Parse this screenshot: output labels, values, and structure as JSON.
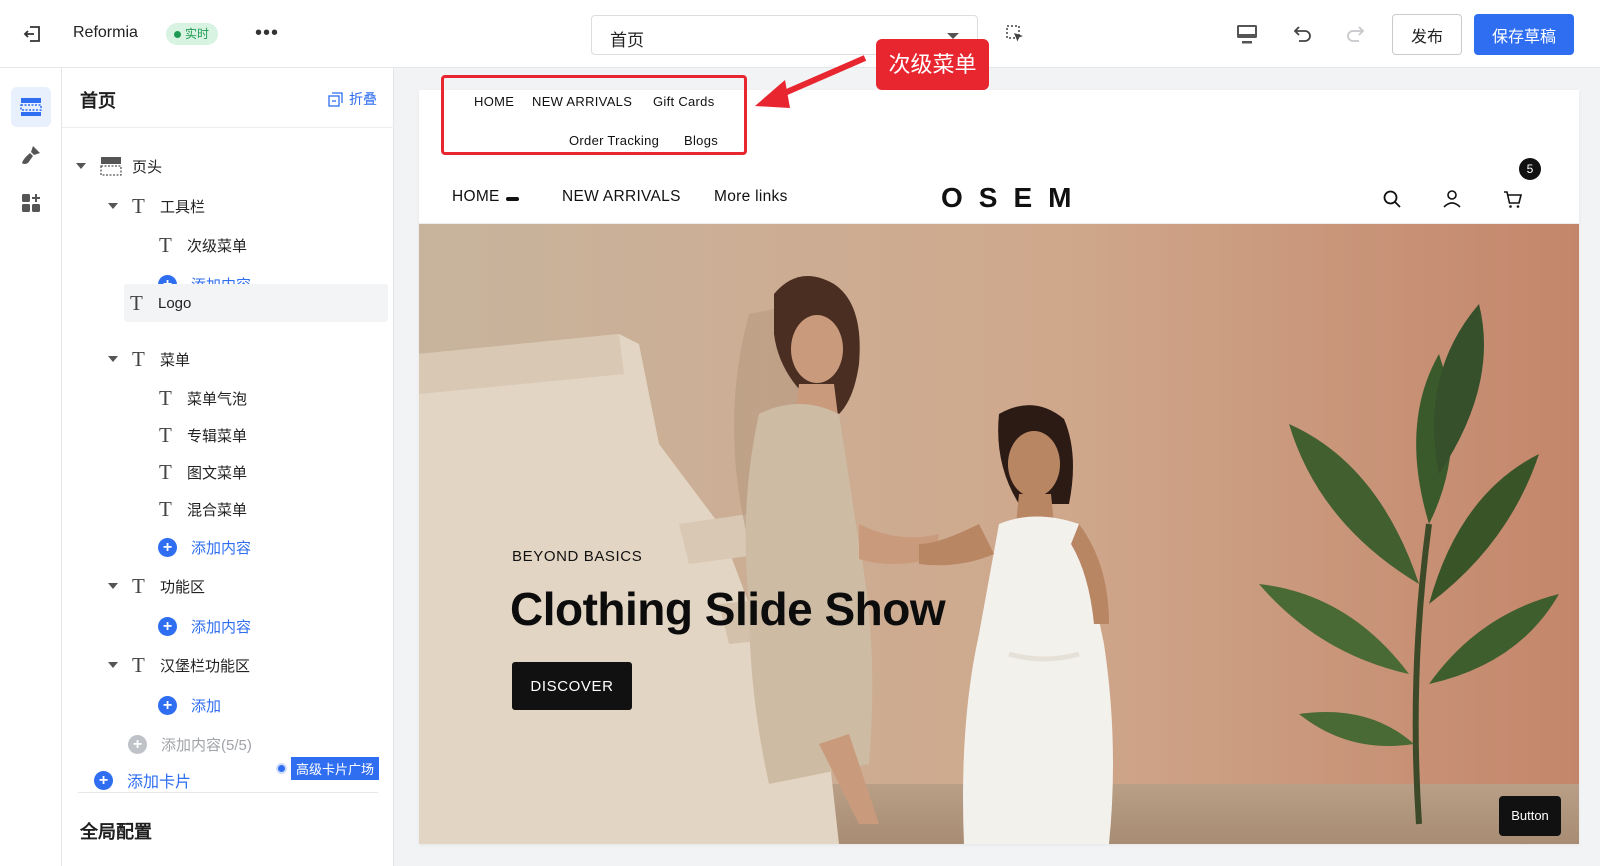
{
  "topbar": {
    "app_name": "Reformia",
    "live_badge": "实时",
    "more": "•••",
    "page_select": "首页",
    "publish": "发布",
    "save_draft": "保存草稿"
  },
  "panel": {
    "title": "首页",
    "collapse": "折叠",
    "tree": [
      {
        "label": "页头",
        "icon": "header-section-icon"
      },
      {
        "label": "工具栏",
        "icon": "text-t-icon"
      },
      {
        "label": "次级菜单",
        "icon": "text-t-icon"
      },
      {
        "label": "添加内容",
        "icon": "plus-circle-icon"
      },
      {
        "label": "Logo",
        "icon": "text-t-icon"
      },
      {
        "label": "菜单",
        "icon": "text-t-icon"
      },
      {
        "label": "菜单气泡",
        "icon": "text-t-icon"
      },
      {
        "label": "专辑菜单",
        "icon": "text-t-icon"
      },
      {
        "label": "图文菜单",
        "icon": "text-t-icon"
      },
      {
        "label": "混合菜单",
        "icon": "text-t-icon"
      },
      {
        "label": "添加内容",
        "icon": "plus-circle-icon"
      },
      {
        "label": "功能区",
        "icon": "text-t-icon"
      },
      {
        "label": "添加内容",
        "icon": "plus-circle-icon"
      },
      {
        "label": "汉堡栏功能区",
        "icon": "text-t-icon"
      },
      {
        "label": "添加",
        "icon": "plus-circle-icon"
      },
      {
        "label": "添加内容(5/5)",
        "icon": "plus-circle-icon"
      }
    ],
    "add_card": "添加卡片",
    "premium_cards": "高级卡片广场",
    "global_config": "全局配置"
  },
  "preview": {
    "sub_menu": [
      "HOME",
      "NEW ARRIVALS",
      "Gift Cards",
      "Order Tracking",
      "Blogs"
    ],
    "main_nav": [
      "HOME",
      "NEW ARRIVALS",
      "More links"
    ],
    "logo": "OSEM",
    "cart_count": "5",
    "hero": {
      "eyebrow": "BEYOND BASICS",
      "title": "Clothing Slide Show",
      "button": "DISCOVER"
    },
    "tooltip": "Button"
  },
  "annotation": {
    "callout": "次级菜单"
  },
  "colors": {
    "accent": "#2f6ef0",
    "annotation_red": "#e8262f",
    "live_green": "#1e9a52"
  }
}
